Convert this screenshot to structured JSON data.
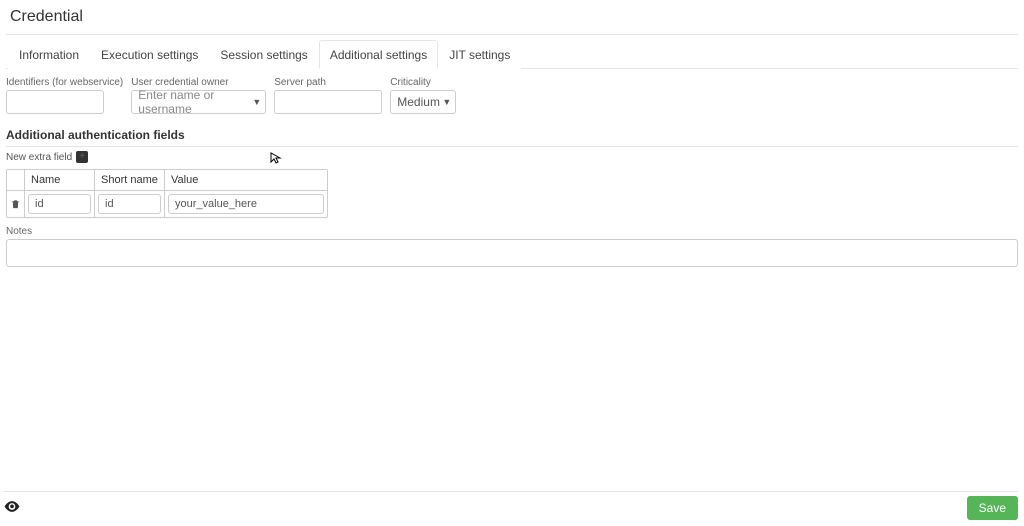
{
  "title": "Credential",
  "tabs": [
    {
      "label": "Information",
      "active": false
    },
    {
      "label": "Execution settings",
      "active": false
    },
    {
      "label": "Session settings",
      "active": false
    },
    {
      "label": "Additional settings",
      "active": true
    },
    {
      "label": "JIT settings",
      "active": false
    }
  ],
  "fields": {
    "identifiers": {
      "label": "Identifiers (for webservice)",
      "value": ""
    },
    "owner": {
      "label": "User credential owner",
      "placeholder": "Enter name or username",
      "value": ""
    },
    "server_path": {
      "label": "Server path",
      "value": ""
    },
    "criticality": {
      "label": "Criticality",
      "value": "Medium"
    }
  },
  "auth_section": {
    "title": "Additional authentication fields",
    "new_field_label": "New extra field",
    "columns": {
      "name": "Name",
      "short_name": "Short name",
      "value": "Value"
    },
    "rows": [
      {
        "name": "id",
        "short_name": "id",
        "value": "your_value_here"
      }
    ]
  },
  "notes": {
    "label": "Notes",
    "value": ""
  },
  "footer": {
    "save": "Save"
  }
}
